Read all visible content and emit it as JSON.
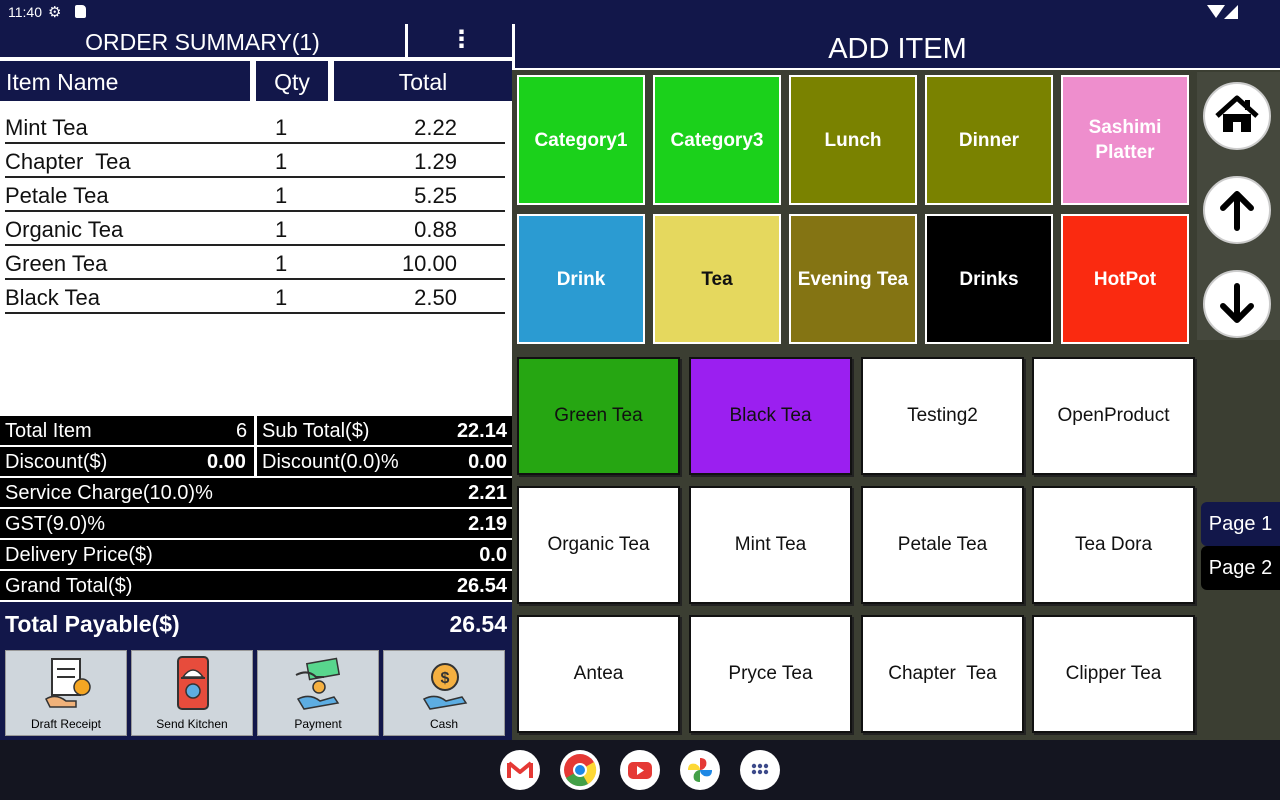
{
  "status": {
    "time": "11:40"
  },
  "order": {
    "title": "ORDER SUMMARY(1)",
    "menu": "⋮",
    "columns": {
      "name": "Item Name",
      "qty": "Qty",
      "total": "Total"
    },
    "items": [
      {
        "name": "Mint Tea",
        "qty": "1",
        "total": "2.22"
      },
      {
        "name": "Chapter  Tea",
        "qty": "1",
        "total": "1.29"
      },
      {
        "name": "Petale Tea",
        "qty": "1",
        "total": "5.25"
      },
      {
        "name": "Organic Tea",
        "qty": "1",
        "total": "0.88"
      },
      {
        "name": "Green Tea",
        "qty": "1",
        "total": "10.00"
      },
      {
        "name": "Black Tea",
        "qty": "1",
        "total": "2.50"
      }
    ]
  },
  "summary": {
    "total_item_label": "Total Item",
    "total_item": "6",
    "subtotal_label": "Sub Total($)",
    "subtotal": "22.14",
    "discount_label": "Discount($)",
    "discount": "0.00",
    "discount_pct_label": "Discount(0.0)%",
    "discount_pct": "0.00",
    "service_label": "Service Charge(10.0)%",
    "service": "2.21",
    "gst_label": "GST(9.0)%",
    "gst": "2.19",
    "delivery_label": "Delivery Price($)",
    "delivery": "0.0",
    "grand_label": "Grand Total($)",
    "grand": "26.54",
    "payable_label": "Total Payable($)",
    "payable": "26.54"
  },
  "actions": [
    "Draft Receipt",
    "Send Kitchen",
    "Payment",
    "Cash"
  ],
  "add_item": {
    "title": "ADD ITEM"
  },
  "categories": [
    {
      "label": "Category1",
      "color": "#1bd11b",
      "text": "#ffffff"
    },
    {
      "label": "Category3",
      "color": "#1bd11b",
      "text": "#ffffff"
    },
    {
      "label": "Lunch",
      "color": "#7a8200",
      "text": "#ffffff"
    },
    {
      "label": "Dinner",
      "color": "#7a8200",
      "text": "#ffffff"
    },
    {
      "label": "Sashimi Platter",
      "color": "#ee8ecd",
      "text": "#ffffff"
    },
    {
      "label": "Drink",
      "color": "#2b9bd2",
      "text": "#ffffff"
    },
    {
      "label": "Tea",
      "color": "#e5d85e",
      "text": "#111111"
    },
    {
      "label": "Evening Tea",
      "color": "#847413",
      "text": "#ffffff"
    },
    {
      "label": "Drinks",
      "color": "#000000",
      "text": "#ffffff"
    },
    {
      "label": "HotPot",
      "color": "#fa2a10",
      "text": "#ffffff"
    }
  ],
  "products": [
    {
      "label": "Green Tea",
      "color": "#26a612"
    },
    {
      "label": "Black Tea",
      "color": "#9b1ff0"
    },
    {
      "label": "Testing2",
      "color": "#ffffff"
    },
    {
      "label": "OpenProduct",
      "color": "#ffffff"
    },
    {
      "label": "Organic Tea",
      "color": "#ffffff"
    },
    {
      "label": "Mint Tea",
      "color": "#ffffff"
    },
    {
      "label": "Petale Tea",
      "color": "#ffffff"
    },
    {
      "label": "Tea Dora",
      "color": "#ffffff"
    },
    {
      "label": "Antea",
      "color": "#ffffff"
    },
    {
      "label": "Pryce Tea",
      "color": "#ffffff"
    },
    {
      "label": "Chapter  Tea",
      "color": "#ffffff"
    },
    {
      "label": "Clipper Tea",
      "color": "#ffffff"
    }
  ],
  "nav": {
    "home": "home-icon",
    "up": "arrow-up-icon",
    "down": "arrow-down-icon"
  },
  "pages": [
    "Page 1",
    "Page 2"
  ],
  "dock": [
    "gmail-icon",
    "chrome-icon",
    "youtube-icon",
    "photos-icon",
    "apps-icon"
  ]
}
